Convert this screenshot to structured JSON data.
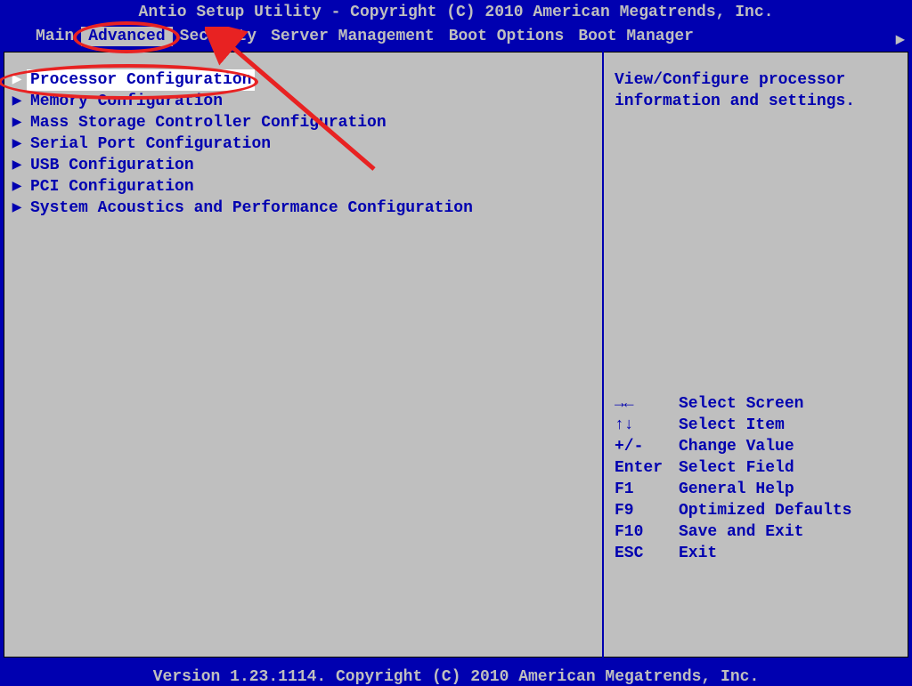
{
  "header": {
    "title": "Antio Setup Utility - Copyright (C) 2010 American Megatrends, Inc."
  },
  "menu": {
    "items": [
      {
        "label": "Main",
        "selected": false
      },
      {
        "label": "Advanced",
        "selected": true
      },
      {
        "label": "Security",
        "selected": false
      },
      {
        "label": "Server Management",
        "selected": false
      },
      {
        "label": "Boot Options",
        "selected": false
      },
      {
        "label": "Boot Manager",
        "selected": false
      }
    ]
  },
  "config_items": [
    {
      "label": "Processor Configuration",
      "selected": true
    },
    {
      "label": "Memory Configuration",
      "selected": false
    },
    {
      "label": "Mass Storage Controller Configuration",
      "selected": false
    },
    {
      "label": "Serial Port Configuration",
      "selected": false
    },
    {
      "label": "USB Configuration",
      "selected": false
    },
    {
      "label": "PCI Configuration",
      "selected": false
    },
    {
      "label": "System Acoustics and Performance Configuration",
      "selected": false
    }
  ],
  "help": {
    "line1": "View/Configure processor",
    "line2": "information and settings."
  },
  "key_hints": [
    {
      "key": "→←",
      "action": "Select Screen"
    },
    {
      "key": "↑↓",
      "action": "Select Item"
    },
    {
      "key": "+/-",
      "action": "Change Value"
    },
    {
      "key": "Enter",
      "action": "Select Field"
    },
    {
      "key": "F1",
      "action": "General Help"
    },
    {
      "key": "F9",
      "action": "Optimized Defaults"
    },
    {
      "key": "F10",
      "action": "Save and Exit"
    },
    {
      "key": "ESC",
      "action": "Exit"
    }
  ],
  "footer": {
    "text": "Version 1.23.1114. Copyright (C) 2010 American Megatrends, Inc."
  }
}
